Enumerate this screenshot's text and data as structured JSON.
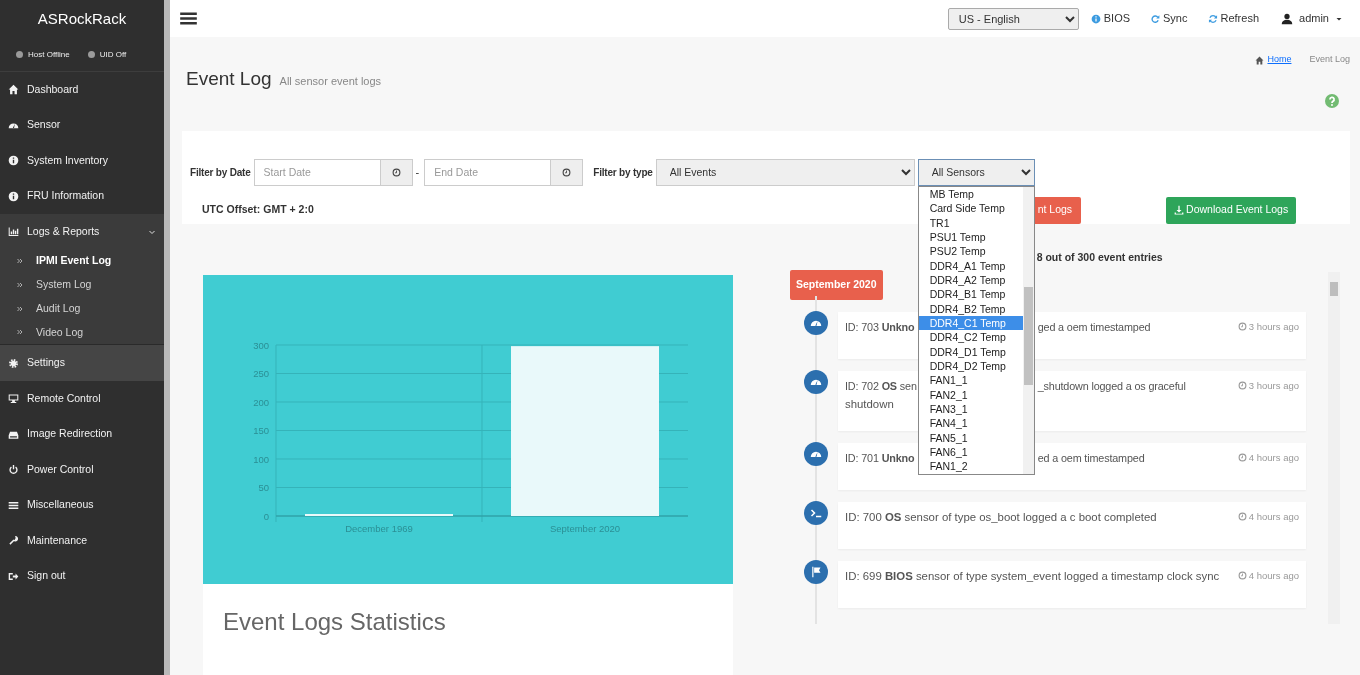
{
  "sidebar": {
    "brand": "ASRockRack",
    "status": [
      {
        "label": "Host Offline"
      },
      {
        "label": "UID Off"
      }
    ],
    "menu": [
      {
        "label": "Dashboard",
        "highlighted": false
      },
      {
        "label": "Sensor",
        "highlighted": false
      },
      {
        "label": "System Inventory",
        "highlighted": false
      },
      {
        "label": "FRU Information",
        "highlighted": false
      },
      {
        "label": "Logs & Reports",
        "highlighted": false,
        "expanded": true,
        "children": [
          {
            "label": "IPMI Event Log",
            "selected": true
          },
          {
            "label": "System Log",
            "selected": false
          },
          {
            "label": "Audit Log",
            "selected": false
          },
          {
            "label": "Video Log",
            "selected": false
          }
        ]
      },
      {
        "label": "Settings",
        "highlighted": true
      },
      {
        "label": "Remote Control",
        "highlighted": false
      },
      {
        "label": "Image Redirection",
        "highlighted": false
      },
      {
        "label": "Power Control",
        "highlighted": false
      },
      {
        "label": "Miscellaneous",
        "highlighted": false
      },
      {
        "label": "Maintenance",
        "highlighted": false
      },
      {
        "label": "Sign out",
        "highlighted": false
      }
    ]
  },
  "topbar": {
    "language": "US - English",
    "links": [
      "BIOS",
      "Sync",
      "Refresh"
    ],
    "user": "admin"
  },
  "header": {
    "title": "Event Log",
    "subtitle": "All sensor event logs",
    "breadcrumb": [
      "Home",
      "Event Log"
    ]
  },
  "filters": {
    "date_label": "Filter by Date",
    "start_date": {
      "placeholder": "Start Date"
    },
    "separator": "-",
    "end_date": {
      "placeholder": "End Date"
    },
    "type_label": "Filter by type",
    "event_type": "All Events",
    "sensor": "All Sensors",
    "utc_offset": "UTC Offset: GMT + 2:0",
    "sensor_options": [
      {
        "label": "MB Temp",
        "selected": false
      },
      {
        "label": "Card Side Temp",
        "selected": false
      },
      {
        "label": "TR1",
        "selected": false
      },
      {
        "label": "PSU1 Temp",
        "selected": false
      },
      {
        "label": "PSU2 Temp",
        "selected": false
      },
      {
        "label": "DDR4_A1 Temp",
        "selected": false
      },
      {
        "label": "DDR4_A2 Temp",
        "selected": false
      },
      {
        "label": "DDR4_B1 Temp",
        "selected": false
      },
      {
        "label": "DDR4_B2 Temp",
        "selected": false
      },
      {
        "label": "DDR4_C1 Temp",
        "selected": true
      },
      {
        "label": "DDR4_C2 Temp",
        "selected": false
      },
      {
        "label": "DDR4_D1 Temp",
        "selected": false
      },
      {
        "label": "DDR4_D2 Temp",
        "selected": false
      },
      {
        "label": "FAN1_1",
        "selected": false
      },
      {
        "label": "FAN2_1",
        "selected": false
      },
      {
        "label": "FAN3_1",
        "selected": false
      },
      {
        "label": "FAN4_1",
        "selected": false
      },
      {
        "label": "FAN5_1",
        "selected": false
      },
      {
        "label": "FAN6_1",
        "selected": false
      },
      {
        "label": "FAN1_2",
        "selected": false
      }
    ],
    "clear_button": "nt Logs",
    "download_button": "Download Event Logs"
  },
  "entries_summary": "8 out of 300 event entries",
  "chart": {
    "title": "Event Logs Statistics",
    "chart_data": {
      "type": "bar",
      "categories": [
        "December 1969",
        "September 2020"
      ],
      "values": [
        1,
        298
      ],
      "ylim": [
        0,
        300
      ],
      "grid": true,
      "yticks": [
        0,
        50,
        100,
        150,
        200,
        250,
        300
      ]
    }
  },
  "timeline": {
    "month": "September 2020",
    "events": [
      {
        "id": "ID: 703",
        "sensor": "Unkno",
        "covered": true,
        "text": "ged a oem timestamped",
        "time": "3 hours ago"
      },
      {
        "id": "ID: 702",
        "sensor": "OS",
        "lead": "sen",
        "covered": true,
        "text": "_shutdown logged a os graceful",
        "continuation": "shutdown",
        "time": "3 hours ago"
      },
      {
        "id": "ID: 701",
        "sensor": "Unkno",
        "covered": true,
        "text": "ed a oem timestamped",
        "time": "4 hours ago"
      },
      {
        "id": "ID: 700",
        "sensor": "OS",
        "covered": false,
        "text": "sensor of type os_boot logged a c boot completed",
        "time": "4 hours ago"
      },
      {
        "id": "ID: 699",
        "sensor": "BIOS",
        "covered": false,
        "text": "sensor of type system_event logged a timestamp clock sync",
        "time": "4 hours ago"
      }
    ]
  }
}
